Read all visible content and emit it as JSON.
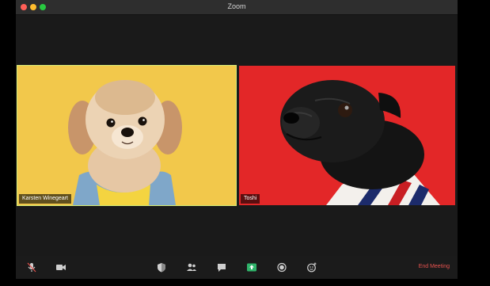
{
  "window": {
    "title": "Zoom"
  },
  "participants": [
    {
      "name": "Karsten Winegeart",
      "tile_color": "#f2c84b",
      "active_speaker": true
    },
    {
      "name": "Toshi",
      "tile_color": "#e32728",
      "active_speaker": false
    }
  ],
  "toolbar": {
    "icons": [
      "microphone-icon",
      "video-camera-icon",
      "security-shield-icon",
      "participants-icon",
      "chat-icon",
      "share-screen-icon",
      "record-icon",
      "reactions-icon"
    ],
    "end_meeting_label": "End Meeting",
    "share_accent": "#2fb36a",
    "end_meeting_color": "#e8534f"
  }
}
